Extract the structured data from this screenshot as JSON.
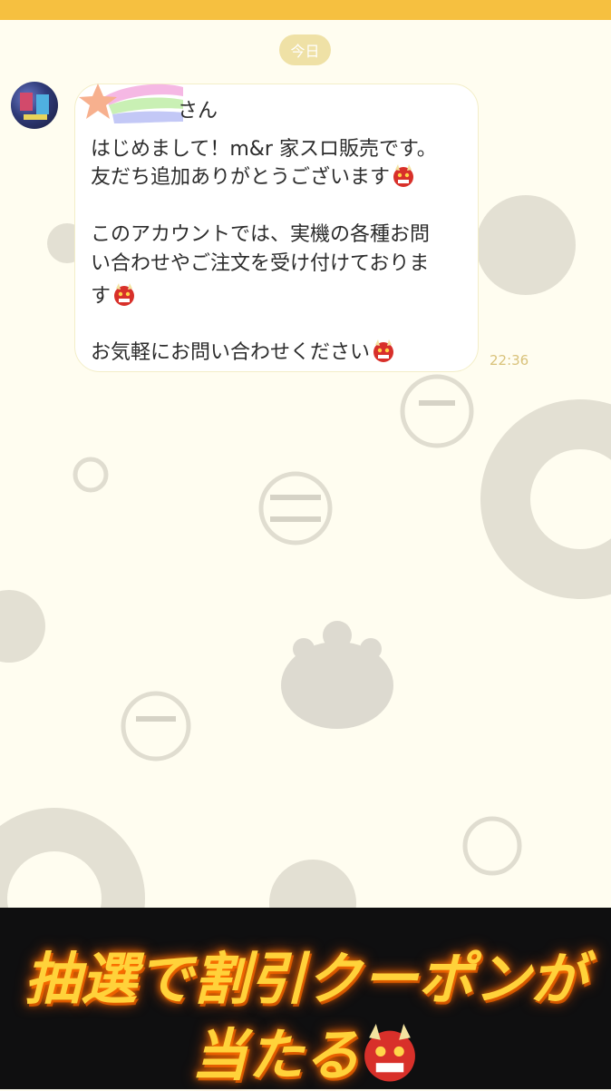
{
  "header": {
    "date_pill": "今日"
  },
  "message": {
    "sender_avatar": "avatar",
    "lines": [
      "さん",
      "はじめまして！m&r 家スロ販売です。",
      "友だち追加ありがとうございます",
      "このアカウントでは、実機の各種お問",
      "い合わせやご注文を受け付けておりま",
      "す",
      "お気軽にお問い合わせください"
    ],
    "time": "22:36",
    "emoji_icon": "oni-face-icon"
  },
  "banner": {
    "line1": "抽選で割引クーポンが",
    "line2": "当たる"
  },
  "colors": {
    "topbar": "#f6c040",
    "background": "#fffdf0",
    "banner_text": "#ffd23a"
  }
}
